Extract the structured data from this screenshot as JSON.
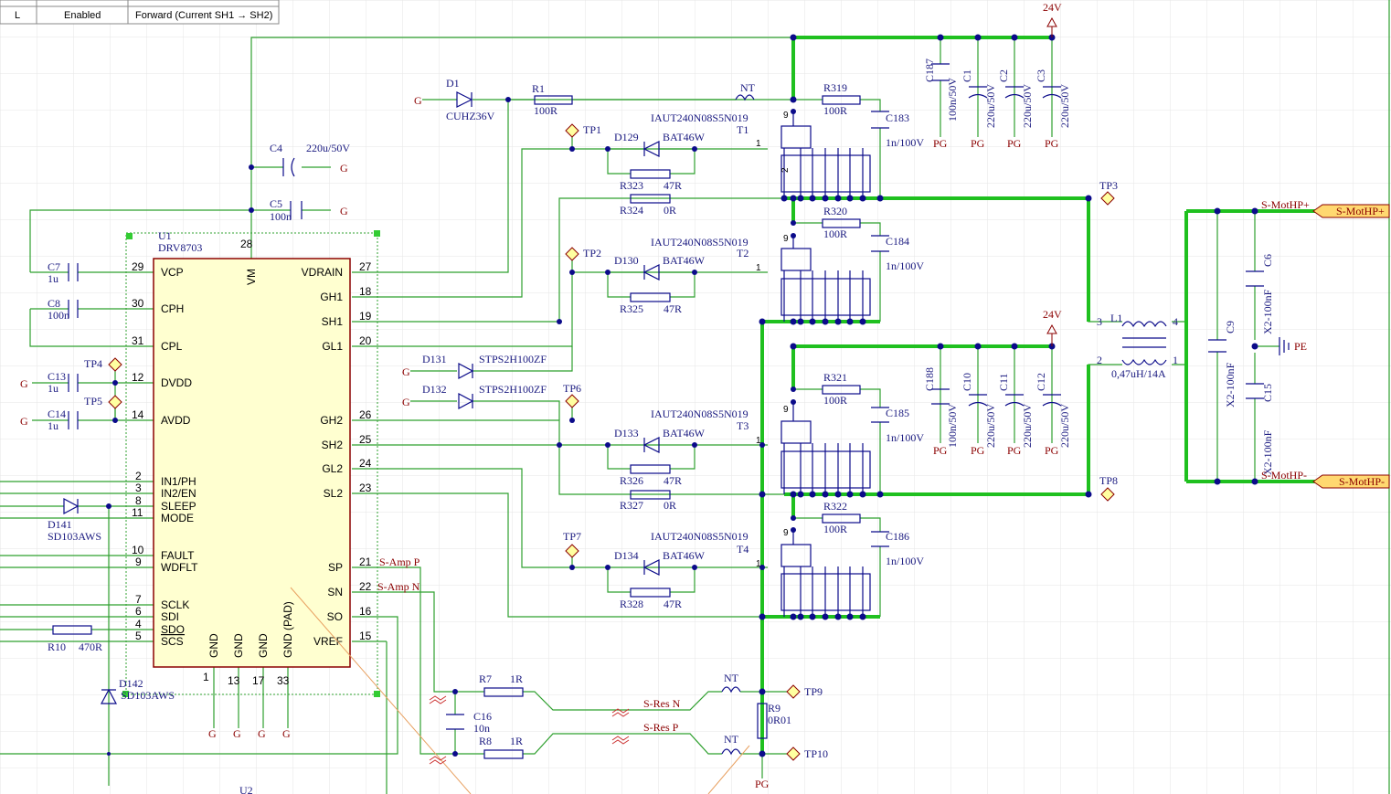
{
  "table": {
    "rows": [
      {
        "col1": "L",
        "col2": "Enabled",
        "col3": "Forward (Current SH1 → SH2)"
      }
    ]
  },
  "ic": {
    "ref": "U1",
    "part": "DRV8703",
    "left_pins": [
      {
        "num": "29",
        "name": "VCP"
      },
      {
        "num": "30",
        "name": "CPH"
      },
      {
        "num": "31",
        "name": "CPL"
      },
      {
        "num": "12",
        "name": "DVDD"
      },
      {
        "num": "14",
        "name": "AVDD"
      },
      {
        "num": "2",
        "name": "IN1/PH"
      },
      {
        "num": "3",
        "name": "IN2/EN"
      },
      {
        "num": "8",
        "name": "SLEEP"
      },
      {
        "num": "11",
        "name": "MODE"
      },
      {
        "num": "10",
        "name": "FAULT"
      },
      {
        "num": "9",
        "name": "WDFLT"
      },
      {
        "num": "7",
        "name": "SCLK"
      },
      {
        "num": "6",
        "name": "SDI"
      },
      {
        "num": "4",
        "name": "SDO"
      },
      {
        "num": "5",
        "name": "SCS"
      }
    ],
    "right_pins": [
      {
        "num": "27",
        "name": "VDRAIN"
      },
      {
        "num": "18",
        "name": "GH1"
      },
      {
        "num": "19",
        "name": "SH1"
      },
      {
        "num": "20",
        "name": "GL1"
      },
      {
        "num": "26",
        "name": "GH2"
      },
      {
        "num": "25",
        "name": "SH2"
      },
      {
        "num": "24",
        "name": "GL2"
      },
      {
        "num": "23",
        "name": "SL2"
      },
      {
        "num": "21",
        "name": "SP"
      },
      {
        "num": "22",
        "name": "SN"
      },
      {
        "num": "16",
        "name": "SO"
      },
      {
        "num": "15",
        "name": "VREF"
      }
    ],
    "top_pin": {
      "num": "28",
      "name": "VM"
    },
    "bottom_pins": [
      {
        "num": "1",
        "name": "GND"
      },
      {
        "num": "13",
        "name": "GND"
      },
      {
        "num": "17",
        "name": "GND"
      },
      {
        "num": "33",
        "name": "GND (PAD)"
      }
    ]
  },
  "labels": {
    "c4": "C4",
    "c4v": "220u/50V",
    "c5": "C5",
    "c5v": "100n",
    "c7": "C7",
    "c7v": "1u",
    "c8": "C8",
    "c8v": "100n",
    "c13": "C13",
    "c13v": "1u",
    "c14": "C14",
    "c14v": "1u",
    "tp4": "TP4",
    "tp5": "TP5",
    "d1": "D1",
    "d1v": "CUHZ36V",
    "r1": "R1",
    "r1v": "100R",
    "nt": "NT",
    "tp1": "TP1",
    "tp2": "TP2",
    "tp6": "TP6",
    "tp7": "TP7",
    "d129": "D129",
    "d130": "D130",
    "d133": "D133",
    "d134": "D134",
    "bat": "BAT46W",
    "fet": "IAUT240N08S5N019",
    "t1": "T1",
    "t2": "T2",
    "t3": "T3",
    "t4": "T4",
    "r323": "R323",
    "r325": "R325",
    "r326": "R326",
    "r328": "R328",
    "r47": "47R",
    "r324": "R324",
    "r327": "R327",
    "r0": "0R",
    "d131": "D131",
    "d132": "D132",
    "stps": "STPS2H100ZF",
    "d141": "D141",
    "d142": "D142",
    "sd": "SD103AWS",
    "sd2": "SD103AWS",
    "r10": "R10",
    "r10v": "470R",
    "r319": "R319",
    "r320": "R320",
    "r321": "R321",
    "r322": "R322",
    "r100": "100R",
    "c183": "C183",
    "c184": "C184",
    "c185": "C185",
    "c186": "C186",
    "c1n": "1n/100V",
    "c187": "C187",
    "c188": "C188",
    "c100n50": "100n/50V",
    "c1": "C1",
    "c2": "C2",
    "c3": "C3",
    "c10": "C10",
    "c11": "C11",
    "c12": "C12",
    "c220": "220u/50V",
    "v24": "24V",
    "pg": "PG",
    "g": "G",
    "tp3": "TP3",
    "tp8": "TP8",
    "tp9": "TP9",
    "tp10": "TP10",
    "l1": "L1",
    "l1v": "0,47uH/14A",
    "c9": "C9",
    "c6": "C6",
    "c15": "C15",
    "x2": "X2-100nF",
    "pe": "PE",
    "mot_p": "S-MotHP+",
    "mot_n": "S-MotHP-",
    "samp_p": "S-Amp P",
    "samp_n": "S-Amp N",
    "sres_n": "S-Res N",
    "sres_p": "S-Res P",
    "r7": "R7",
    "r8": "R8",
    "r1r": "1R",
    "c16": "C16",
    "c16v": "10n",
    "r9": "R9",
    "r9v": "0R01",
    "u2": "U2"
  },
  "colors": {
    "wire": "#2fa02f",
    "bus": "#1fc01f",
    "component": "#0b0b8a",
    "net_label": "#8b0000"
  }
}
